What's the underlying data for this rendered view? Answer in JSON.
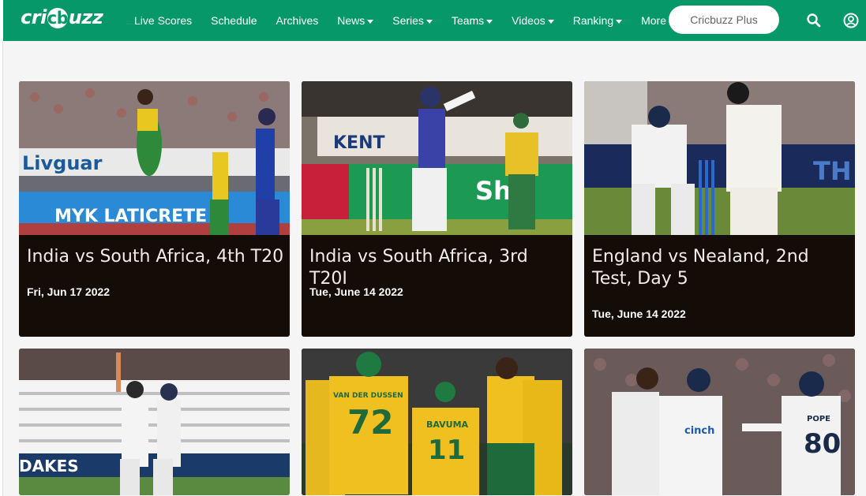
{
  "header": {
    "logo": {
      "pre": "cri",
      "ball": "cb",
      "post": "uzz"
    },
    "nav": [
      {
        "label": "Live Scores",
        "dropdown": false
      },
      {
        "label": "Schedule",
        "dropdown": false
      },
      {
        "label": "Archives",
        "dropdown": false
      },
      {
        "label": "News",
        "dropdown": true
      },
      {
        "label": "Series",
        "dropdown": true
      },
      {
        "label": "Teams",
        "dropdown": true
      },
      {
        "label": "Videos",
        "dropdown": true
      },
      {
        "label": "Ranking",
        "dropdown": true
      },
      {
        "label": "More",
        "dropdown": true
      }
    ],
    "plus_button": "Cricbuzz Plus",
    "icons": [
      "search-icon",
      "user-icon"
    ],
    "brand_color": "#069868"
  },
  "cards": [
    {
      "title": "India vs South Africa, 4th T20",
      "date": "Fri, Jun 17 2022"
    },
    {
      "title": "India vs South Africa, 3rd T20I",
      "date": "Tue, June 14 2022"
    },
    {
      "title": "England vs Nealand, 2nd Test, Day 5",
      "date": "Tue, June 14 2022"
    },
    {
      "title": "",
      "date": ""
    },
    {
      "title": "",
      "date": ""
    },
    {
      "title": "",
      "date": ""
    }
  ],
  "photo_text": {
    "card1_banner": "MYK LATICRETE",
    "card1_board": "Livguar",
    "card2_board": "KENT",
    "card2_board2": "Shi",
    "card3_board": "TH",
    "card4_board": "DAKES",
    "card5_name1": "VAN DER DUSSEN",
    "card5_num1": "72",
    "card5_name2": "BAVUMA",
    "card5_num2": "11",
    "card6_sponsor": "cinch",
    "card6_name": "POPE",
    "card6_num": "80"
  },
  "colors": {
    "card_bg": "#140c07",
    "page_bg": "#f5f5f5"
  }
}
